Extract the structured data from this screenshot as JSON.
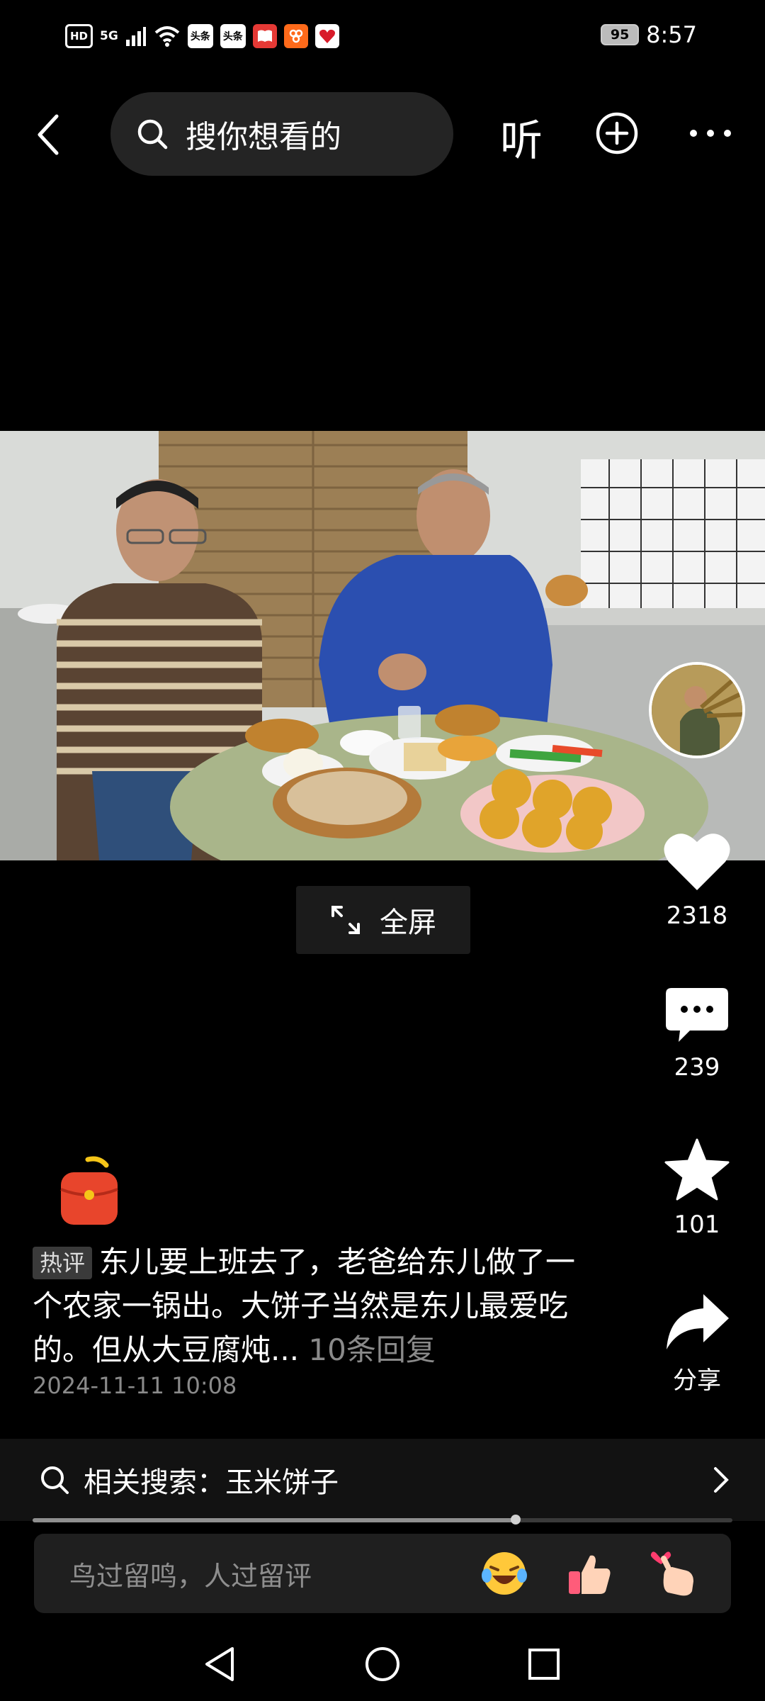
{
  "status_bar": {
    "indicators": [
      "HD",
      "5G"
    ],
    "app_icons": [
      "头条",
      "头条"
    ],
    "battery": "95",
    "time": "8:57"
  },
  "top_nav": {
    "search_placeholder": "搜你想看的",
    "listen_label": "听"
  },
  "video": {
    "fullscreen_label": "全屏"
  },
  "actions": {
    "likes": "2318",
    "comments": "239",
    "favorites": "101",
    "share_label": "分享"
  },
  "post": {
    "hot_tag": "热评",
    "text": "东儿要上班去了，老爸给东儿做了一个农家一锅出。大饼子当然是东儿最爱吃的。但从大豆腐炖...",
    "replies": "10条回复",
    "timestamp": "2024-11-11 10:08"
  },
  "related_search": {
    "label": "相关搜索：玉米饼子"
  },
  "progress": {
    "fraction": 0.69
  },
  "comment_bar": {
    "placeholder": "鸟过留鸣，人过留评"
  },
  "icons": [
    "back-icon",
    "search-icon",
    "plus-circle-icon",
    "more-icon",
    "fullscreen-icon",
    "heart-icon",
    "comment-icon",
    "star-icon",
    "share-icon",
    "red-packet-icon",
    "chevron-right-icon",
    "laugh-emoji-icon",
    "thumbs-up-emoji-icon",
    "finger-heart-emoji-icon",
    "nav-back-icon",
    "nav-home-icon",
    "nav-recents-icon"
  ],
  "colors": {
    "background": "#000000",
    "search_bg": "#242424",
    "secondary_text": "#8a8a8a",
    "red_packet": "#e8452c"
  }
}
